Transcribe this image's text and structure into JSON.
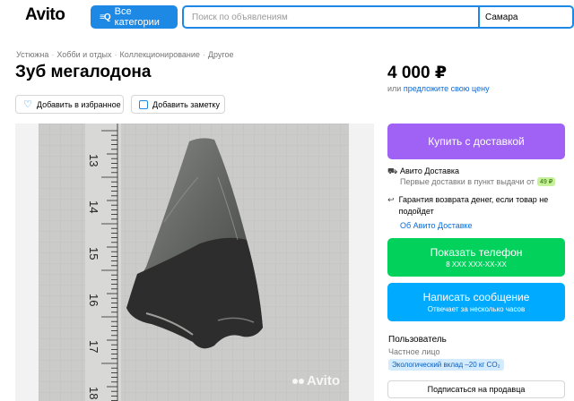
{
  "header": {
    "logo": "Avito",
    "categories_button": "Все категории",
    "search_placeholder": "Поиск по объявлениям",
    "city": "Самара"
  },
  "breadcrumb": [
    "Устюжна",
    "Хобби и отдых",
    "Коллекционирование",
    "Другое"
  ],
  "listing": {
    "title": "Зуб мегалодона",
    "price": "4 000 ₽",
    "offer_prefix": "или",
    "offer_link": "предложите свою цену",
    "favorite_button": "Добавить в избранное",
    "note_button": "Добавить заметку",
    "photo_watermark": "Avito",
    "ruler_labels": [
      "13",
      "14",
      "15",
      "16",
      "17",
      "18"
    ]
  },
  "sidebar": {
    "buy_button": "Купить с доставкой",
    "delivery_title": "Авито Доставка",
    "delivery_sub": "Первые доставки в пункт выдачи от",
    "delivery_price": "49 ₽",
    "guarantee": "Гарантия возврата денег, если товар не подойдет",
    "about_link": "Об Авито Доставке",
    "phone_button": "Показать телефон",
    "phone_masked": "8 XXX XXX-XX-XX",
    "message_button": "Написать сообщение",
    "message_sub": "Отвечает за несколько часов",
    "seller_name": "Пользователь",
    "seller_type": "Частное лицо",
    "eco_badge": "Экологический вклад –20 кг CO₂",
    "subscribe_button": "Подписаться на продавца"
  },
  "colors": {
    "primary_blue": "#1e88e5",
    "buy_purple": "#9f62f5",
    "phone_green": "#02d15c",
    "message_blue": "#00aaff"
  }
}
